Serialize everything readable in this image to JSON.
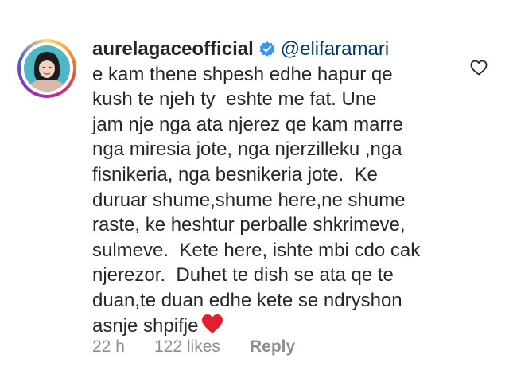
{
  "comment": {
    "username": "aurelagaceofficial",
    "mention": "@elifaramari",
    "lines": [
      "e kam thene shpesh edhe hapur qe",
      "kush te njeh ty  eshte me fat. Une",
      "jam nje nga ata njerez qe kam marre",
      "nga miresia jote, nga njerzilleku ,nga",
      "fisnikeria, nga besnikeria jote.  Ke",
      "duruar shume,shume here,ne shume",
      "raste, ke heshtur perballe shkrimeve,",
      "sulmeve.  Kete here, ishte mbi cdo cak",
      "njerezor.  Duhet te dish se ata qe te",
      "duan,te duan edhe kete se ndryshon",
      "asnje shpifje"
    ],
    "footer": {
      "time": "22 h",
      "likes": "122 likes",
      "reply": "Reply"
    }
  },
  "colors": {
    "verified_badge": "#3897f0",
    "heart_emoji": "#e0202e",
    "mention": "#00376b",
    "meta_text": "#8e8e8e"
  },
  "icons": {
    "verified": "verified-badge-icon",
    "like": "heart-outline-icon",
    "emoji": "red-heart-emoji-icon"
  }
}
